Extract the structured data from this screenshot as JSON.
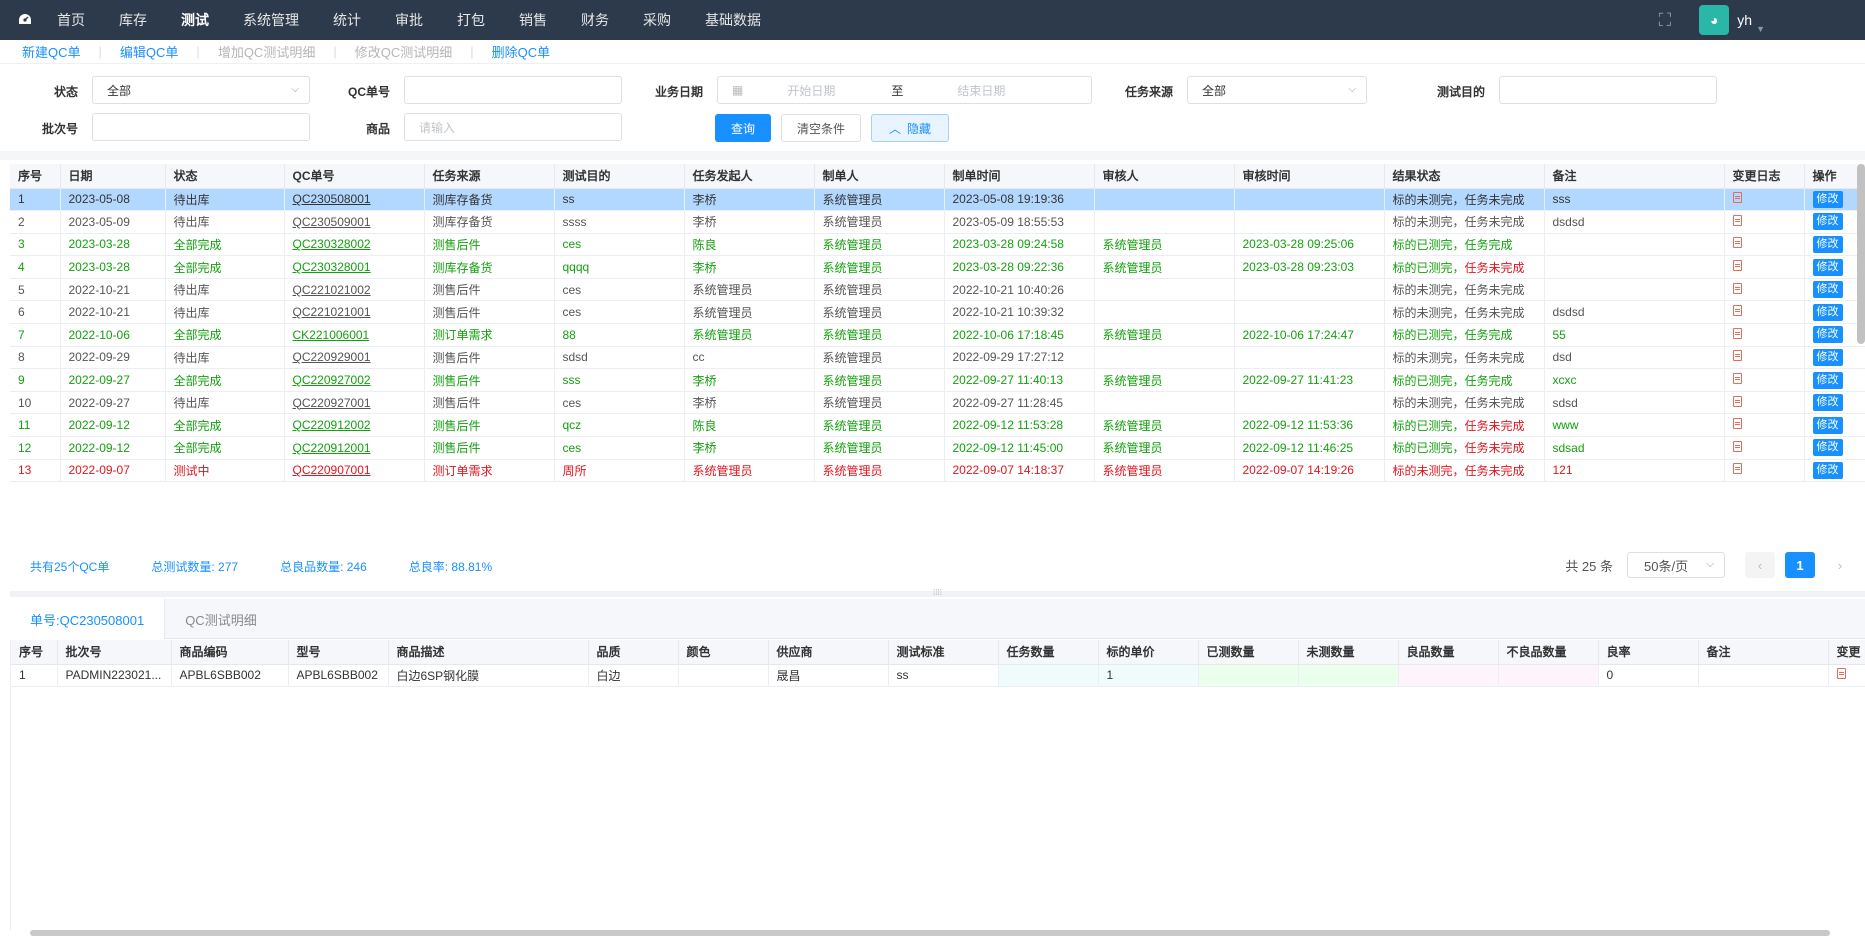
{
  "nav": {
    "items": [
      "首页",
      "库存",
      "测试",
      "系统管理",
      "统计",
      "审批",
      "打包",
      "销售",
      "财务",
      "采购",
      "基础数据"
    ],
    "active_index": 2,
    "username": "yh"
  },
  "toolbar": {
    "new_qc": "新建QC单",
    "edit_qc": "编辑QC单",
    "add_detail": "增加QC测试明细",
    "edit_detail": "修改QC测试明细",
    "delete_qc": "删除QC单"
  },
  "filters": {
    "status_label": "状态",
    "status_value": "全部",
    "qc_no_label": "QC单号",
    "biz_date_label": "业务日期",
    "start_date_placeholder": "开始日期",
    "date_to": "至",
    "end_date_placeholder": "结束日期",
    "source_label": "任务来源",
    "source_value": "全部",
    "purpose_label": "测试目的",
    "batch_label": "批次号",
    "goods_label": "商品",
    "goods_placeholder": "请输入",
    "query_btn": "查询",
    "clear_btn": "清空条件",
    "hide_btn": "隐藏"
  },
  "main_table": {
    "headers": [
      "序号",
      "日期",
      "状态",
      "QC单号",
      "任务来源",
      "测试目的",
      "任务发起人",
      "制单人",
      "制单时间",
      "审核人",
      "审核时间",
      "结果状态",
      "备注",
      "变更日志",
      "操作"
    ],
    "edit_label": "修改",
    "rows": [
      {
        "style": "sel",
        "no": "1",
        "date": "2023-05-08",
        "status": "待出库",
        "qc": "QC230508001",
        "source": "测库存备货",
        "purpose": "ss",
        "initiator": "李桥",
        "maker": "系统管理员",
        "made": "2023-05-08 19:19:36",
        "auditor": "",
        "audited": "",
        "res1": "标的未测完，",
        "res2": "任务未完成",
        "res2red": false,
        "note": "sss"
      },
      {
        "style": "gray",
        "no": "2",
        "date": "2023-05-09",
        "status": "待出库",
        "qc": "QC230509001",
        "source": "测库存备货",
        "purpose": "ssss",
        "initiator": "李桥",
        "maker": "系统管理员",
        "made": "2023-05-09 18:55:53",
        "auditor": "",
        "audited": "",
        "res1": "标的未测完，",
        "res2": "任务未完成",
        "res2red": false,
        "note": "dsdsd"
      },
      {
        "style": "green",
        "no": "3",
        "date": "2023-03-28",
        "status": "全部完成",
        "qc": "QC230328002",
        "source": "测售后件",
        "purpose": "ces",
        "initiator": "陈良",
        "maker": "系统管理员",
        "made": "2023-03-28 09:24:58",
        "auditor": "系统管理员",
        "audited": "2023-03-28 09:25:06",
        "res1": "标的已测完，",
        "res2": "任务完成",
        "res2red": false,
        "note": ""
      },
      {
        "style": "green",
        "no": "4",
        "date": "2023-03-28",
        "status": "全部完成",
        "qc": "QC230328001",
        "source": "测库存备货",
        "purpose": "qqqq",
        "initiator": "李桥",
        "maker": "系统管理员",
        "made": "2023-03-28 09:22:36",
        "auditor": "系统管理员",
        "audited": "2023-03-28 09:23:03",
        "res1": "标的已测完，",
        "res2": "任务未完成",
        "res2red": true,
        "note": ""
      },
      {
        "style": "gray",
        "no": "5",
        "date": "2022-10-21",
        "status": "待出库",
        "qc": "QC221021002",
        "source": "测售后件",
        "purpose": "ces",
        "initiator": "系统管理员",
        "maker": "系统管理员",
        "made": "2022-10-21 10:40:26",
        "auditor": "",
        "audited": "",
        "res1": "标的未测完，",
        "res2": "任务未完成",
        "res2red": false,
        "note": ""
      },
      {
        "style": "gray",
        "no": "6",
        "date": "2022-10-21",
        "status": "待出库",
        "qc": "QC221021001",
        "source": "测售后件",
        "purpose": "ces",
        "initiator": "系统管理员",
        "maker": "系统管理员",
        "made": "2022-10-21 10:39:32",
        "auditor": "",
        "audited": "",
        "res1": "标的未测完，",
        "res2": "任务未完成",
        "res2red": false,
        "note": "dsdsd"
      },
      {
        "style": "green",
        "no": "7",
        "date": "2022-10-06",
        "status": "全部完成",
        "qc": "CK221006001",
        "source": "测订单需求",
        "purpose": "88",
        "initiator": "系统管理员",
        "maker": "系统管理员",
        "made": "2022-10-06 17:18:45",
        "auditor": "系统管理员",
        "audited": "2022-10-06 17:24:47",
        "res1": "标的已测完，",
        "res2": "任务完成",
        "res2red": false,
        "note": "55"
      },
      {
        "style": "gray",
        "no": "8",
        "date": "2022-09-29",
        "status": "待出库",
        "qc": "QC220929001",
        "source": "测售后件",
        "purpose": "sdsd",
        "initiator": "cc",
        "maker": "系统管理员",
        "made": "2022-09-29 17:27:12",
        "auditor": "",
        "audited": "",
        "res1": "标的未测完，",
        "res2": "任务未完成",
        "res2red": false,
        "note": "dsd"
      },
      {
        "style": "green",
        "no": "9",
        "date": "2022-09-27",
        "status": "全部完成",
        "qc": "QC220927002",
        "source": "测售后件",
        "purpose": "sss",
        "initiator": "李桥",
        "maker": "系统管理员",
        "made": "2022-09-27 11:40:13",
        "auditor": "系统管理员",
        "audited": "2022-09-27 11:41:23",
        "res1": "标的已测完，",
        "res2": "任务完成",
        "res2red": false,
        "note": "xcxc"
      },
      {
        "style": "gray",
        "no": "10",
        "date": "2022-09-27",
        "status": "待出库",
        "qc": "QC220927001",
        "source": "测售后件",
        "purpose": "ces",
        "initiator": "李桥",
        "maker": "系统管理员",
        "made": "2022-09-27 11:28:45",
        "auditor": "",
        "audited": "",
        "res1": "标的未测完，",
        "res2": "任务未完成",
        "res2red": false,
        "note": "sdsd"
      },
      {
        "style": "green",
        "no": "11",
        "date": "2022-09-12",
        "status": "全部完成",
        "qc": "QC220912002",
        "source": "测售后件",
        "purpose": "qcz",
        "initiator": "陈良",
        "maker": "系统管理员",
        "made": "2022-09-12 11:53:28",
        "auditor": "系统管理员",
        "audited": "2022-09-12 11:53:36",
        "res1": "标的已测完，",
        "res2": "任务未完成",
        "res2red": true,
        "note": "www"
      },
      {
        "style": "green",
        "no": "12",
        "date": "2022-09-12",
        "status": "全部完成",
        "qc": "QC220912001",
        "source": "测售后件",
        "purpose": "ces",
        "initiator": "李桥",
        "maker": "系统管理员",
        "made": "2022-09-12 11:45:00",
        "auditor": "系统管理员",
        "audited": "2022-09-12 11:46:25",
        "res1": "标的已测完，",
        "res2": "任务未完成",
        "res2red": true,
        "note": "sdsad"
      },
      {
        "style": "red",
        "no": "13",
        "date": "2022-09-07",
        "status": "测试中",
        "qc": "QC220907001",
        "source": "测订单需求",
        "purpose": "周所",
        "initiator": "系统管理员",
        "maker": "系统管理员",
        "made": "2022-09-07 14:18:37",
        "auditor": "系统管理员",
        "audited": "2022-09-07 14:19:26",
        "res1": "标的未测完，",
        "res2": "任务未完成",
        "res2red": false,
        "note": "121"
      }
    ]
  },
  "summary": {
    "qc_count": "共有25个QC单",
    "total_test": "总测试数量: 277",
    "total_good": "总良品数量: 246",
    "yield": "总良率: 88.81%"
  },
  "pager": {
    "total": "共 25 条",
    "page_size": "50条/页",
    "current": "1"
  },
  "tabs": {
    "active": "单号:QC230508001",
    "other": "QC测试明细"
  },
  "detail_table": {
    "headers": [
      "序号",
      "批次号",
      "商品编码",
      "型号",
      "商品描述",
      "品质",
      "颜色",
      "供应商",
      "测试标准",
      "任务数量",
      "标的单价",
      "已测数量",
      "未测数量",
      "良品数量",
      "不良品数量",
      "良率",
      "备注",
      "变更"
    ],
    "rows": [
      [
        "1",
        "PADMIN223021...",
        "APBL6SBB002",
        "APBL6SBB002",
        "白边6SP钢化膜",
        "白边",
        "",
        "晟昌",
        "ss",
        "",
        "1",
        "",
        "",
        "",
        "",
        "0",
        "",
        ""
      ]
    ]
  }
}
